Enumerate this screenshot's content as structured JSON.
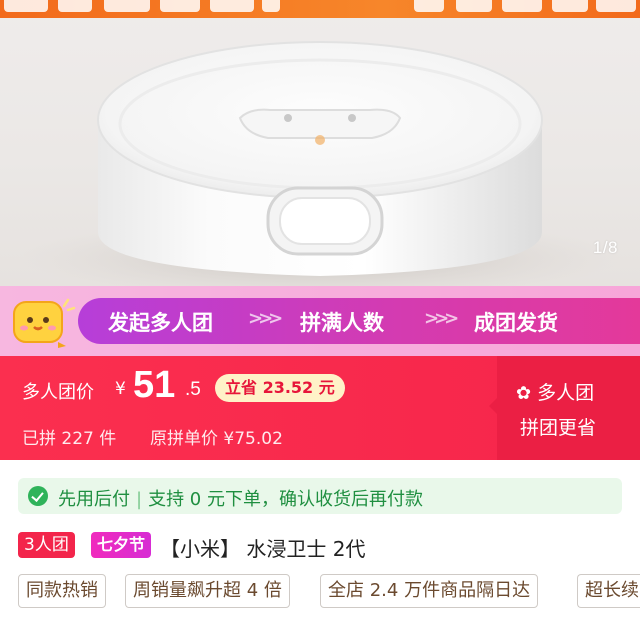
{
  "gallery": {
    "counter": "1/8"
  },
  "flow": {
    "steps": [
      "发起多人团",
      "拼满人数",
      "成团发货"
    ],
    "arrows": ">>>"
  },
  "price": {
    "label": "多人团价",
    "currency": "¥",
    "integer": "51",
    "decimal": ".5",
    "save_badge": "立省 23.52 元",
    "sold_count": "已拼 227 件",
    "original_price": "原拼单价 ¥75.02",
    "group_mode": "多人团",
    "group_sub": "拼团更省"
  },
  "paylater": {
    "left": "先用后付",
    "separator": "|",
    "right": "支持 0 元下单，确认收货后再付款"
  },
  "title": {
    "tag_group": "3人团",
    "tag_festival": "七夕节",
    "text": "【小米】 水浸卫士 2代"
  },
  "chips": [
    "同款热销",
    "周销量飙升超 4 倍",
    "全店 2.4 万件商品隔日达",
    "超长续"
  ],
  "colors": {
    "price_red": "#f6254b",
    "flow_purple": "#b63ed9",
    "paylater_green": "#1f8f40",
    "top_banner_orange": "#f26a1b"
  }
}
